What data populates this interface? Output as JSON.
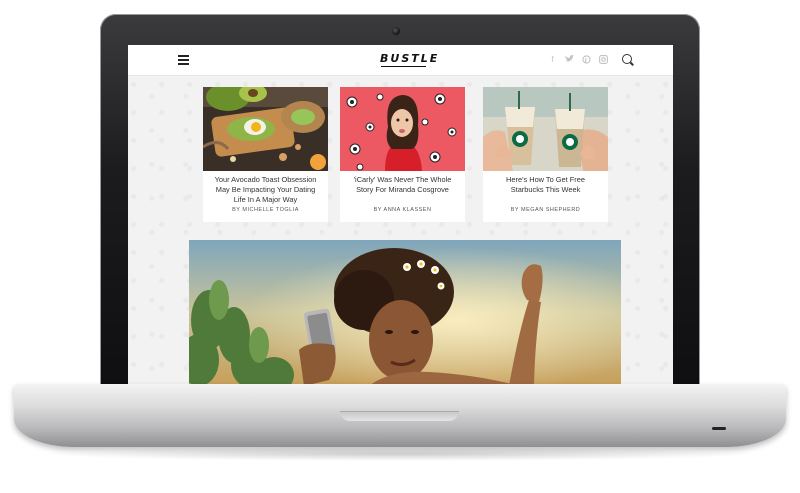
{
  "site": {
    "logo": "BUSTLE"
  },
  "header": {
    "icons": [
      "menu-icon",
      "facebook-icon",
      "twitter-icon",
      "pinterest-icon",
      "instagram-icon",
      "search-icon"
    ]
  },
  "articles": [
    {
      "title": "Your Avocado Toast Obsession May Be Impacting Your Dating Life In A Major Way",
      "byline": "BY MICHELLE TOGLIA"
    },
    {
      "title": "'iCarly' Was Never The Whole Story For Miranda Cosgrove",
      "byline": "BY ANNA KLASSEN"
    },
    {
      "title": "Here's How To Get Free Starbucks This Week",
      "byline": "BY MEGAN SHEPHERD"
    }
  ],
  "colors": {
    "screen_bg": "#f2f2f2",
    "bezel": "#111111",
    "accent_red": "#e94a53"
  }
}
